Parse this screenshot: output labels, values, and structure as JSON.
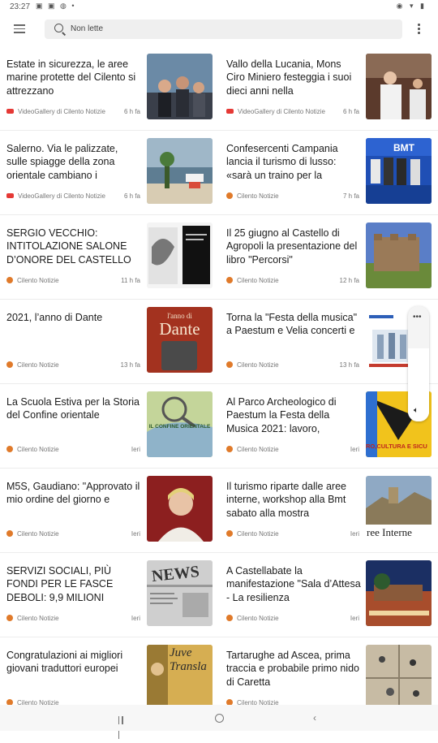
{
  "status": {
    "time": "23:27"
  },
  "search": {
    "placeholder": "Non lette"
  },
  "cards": [
    {
      "title": "Estate in sicurezza, le aree marine protette del Cilento si attrezzano",
      "source": "VideoGallery di Cilento Notizie",
      "time": "6 h fa",
      "source_type": "video"
    },
    {
      "title": "Vallo della Lucania, Mons Ciro Miniero festeggia i suoi dieci anni nella",
      "source": "VideoGallery di Cilento Notizie",
      "time": "6 h fa",
      "source_type": "video"
    },
    {
      "title": "Salerno. Via le palizzate, sulle spiagge della zona orientale cambiano i",
      "source": "VideoGallery di Cilento Notizie",
      "time": "6 h fa",
      "source_type": "video"
    },
    {
      "title": "Confesercenti Campania lancia il turismo di lusso: «sarà un traino per la",
      "source": "Cilento Notizie",
      "time": "7 h fa",
      "source_type": "site"
    },
    {
      "title": "SERGIO VECCHIO: INTITOLAZIONE SALONE D’ONORE DEL CASTELLO",
      "source": "Cilento Notizie",
      "time": "11 h fa",
      "source_type": "site"
    },
    {
      "title": "Il 25 giugno al Castello di Agropoli la presentazione del libro \"Percorsi\"",
      "source": "Cilento Notizie",
      "time": "12 h fa",
      "source_type": "site"
    },
    {
      "title": "2021, l’anno di Dante",
      "source": "Cilento Notizie",
      "time": "13 h fa",
      "source_type": "site",
      "thumb_text": "Dante",
      "thumb_small": "l'anno di"
    },
    {
      "title": "Torna la \"Festa della musica\" a Paestum e Velia concerti e",
      "source": "Cilento Notizie",
      "time": "13 h fa",
      "source_type": "site"
    },
    {
      "title": "La Scuola Estiva per la Storia del Confine orientale",
      "source": "Cilento Notizie",
      "time": "Ieri",
      "source_type": "site",
      "thumb_text": "IL CONFINE ORIENTALE"
    },
    {
      "title": "Al Parco Archeologico di Paestum la Festa della Musica 2021: lavoro,",
      "source": "Cilento Notizie",
      "time": "Ieri",
      "source_type": "site",
      "thumb_text": "RO,CULTURA E SICU"
    },
    {
      "title": "M5S, Gaudiano: \"Approvato il mio ordine del giorno e",
      "source": "Cilento Notizie",
      "time": "Ieri",
      "source_type": "site"
    },
    {
      "title": "Il turismo riparte dalle aree interne, workshop alla Bmt sabato alla mostra",
      "source": "Cilento Notizie",
      "time": "Ieri",
      "source_type": "site",
      "thumb_text": "ree Interne"
    },
    {
      "title": "SERVIZI SOCIALI, PIÙ FONDI PER LE FASCE DEBOLI:  9,9 MILIONI",
      "source": "Cilento Notizie",
      "time": "Ieri",
      "source_type": "site",
      "thumb_text": "NEWS"
    },
    {
      "title": "A Castellabate la manifestazione \"Sala d’Attesa - La resilienza",
      "source": "Cilento Notizie",
      "time": "Ieri",
      "source_type": "site"
    },
    {
      "title": "Congratulazioni ai migliori giovani traduttori europei",
      "source": "Cilento Notizie",
      "time": "",
      "source_type": "site",
      "thumb_text": "Juve Transla"
    },
    {
      "title": "Tartarughe ad Ascea, prima traccia e probabile primo nido di Caretta",
      "source": "Cilento Notizie",
      "time": "",
      "source_type": "site"
    }
  ],
  "icons": {
    "menu": "hamburger-icon",
    "search": "search-icon",
    "more": "more-vert-icon",
    "nav_recents": "recents-icon",
    "nav_home": "home-icon",
    "nav_back": "back-icon"
  },
  "colors": {
    "site_dot": "#e07a2a",
    "video_badge": "#e53935"
  }
}
